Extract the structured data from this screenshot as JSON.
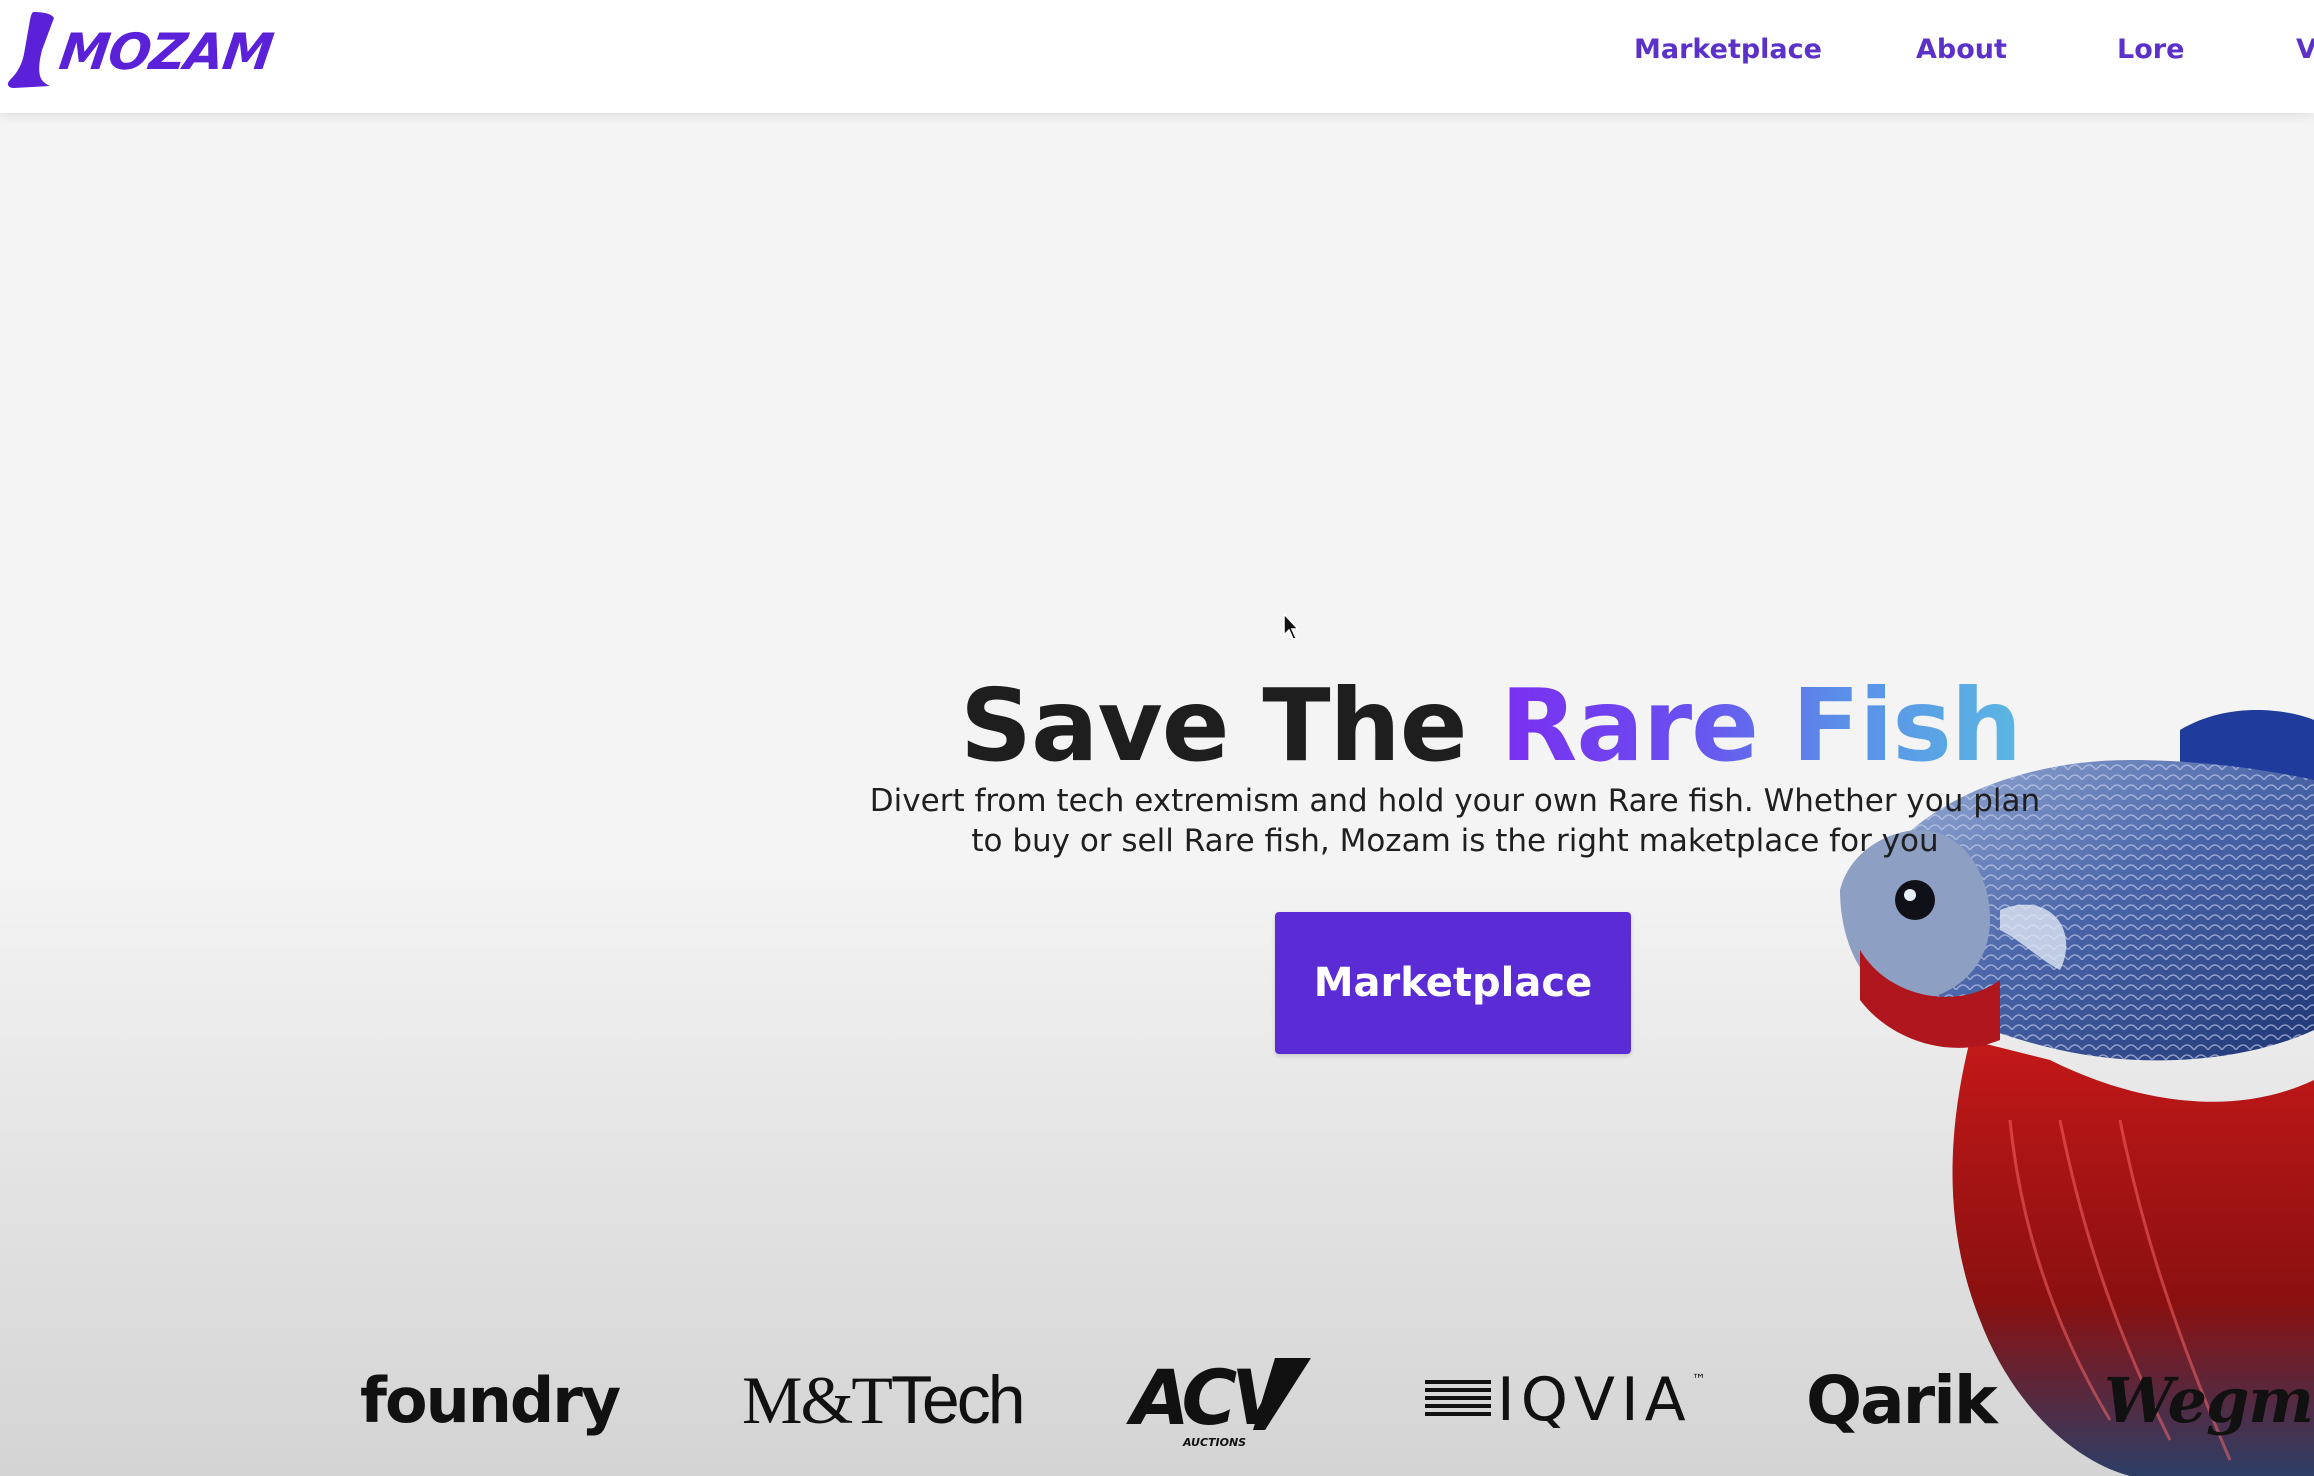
{
  "header": {
    "logo_text": "MOZAM",
    "nav": [
      {
        "label": "Marketplace"
      },
      {
        "label": "About"
      },
      {
        "label": "Lore"
      },
      {
        "label": "V"
      }
    ]
  },
  "hero": {
    "title_plain": "Save The ",
    "title_accent": "Rare Fish",
    "subtitle": "Divert from tech extremism and hold your own Rare fish. Whether you plan to buy or sell Rare fish, Mozam is the right maketplace for you",
    "cta_label": "Marketplace"
  },
  "brands": {
    "foundry": "foundry",
    "mt_prefix": "M&T",
    "mt_suffix": "Tech",
    "acv": "ACV",
    "acv_sub": "AUCTIONS",
    "iqvia": "IQVIA",
    "iqvia_tm": "™",
    "qarik": "Qarik",
    "wegmans": "Wegmans"
  },
  "colors": {
    "brand_purple": "#5b2bd6",
    "nav_purple": "#5b31c9",
    "accent_gradient_start": "#7a2ff0",
    "accent_gradient_end": "#5bb7e2"
  },
  "icons": {
    "logo_mark": "fish-tail-logo-icon",
    "cursor": "mouse-pointer-icon",
    "hero_image": "betta-fish-image"
  }
}
